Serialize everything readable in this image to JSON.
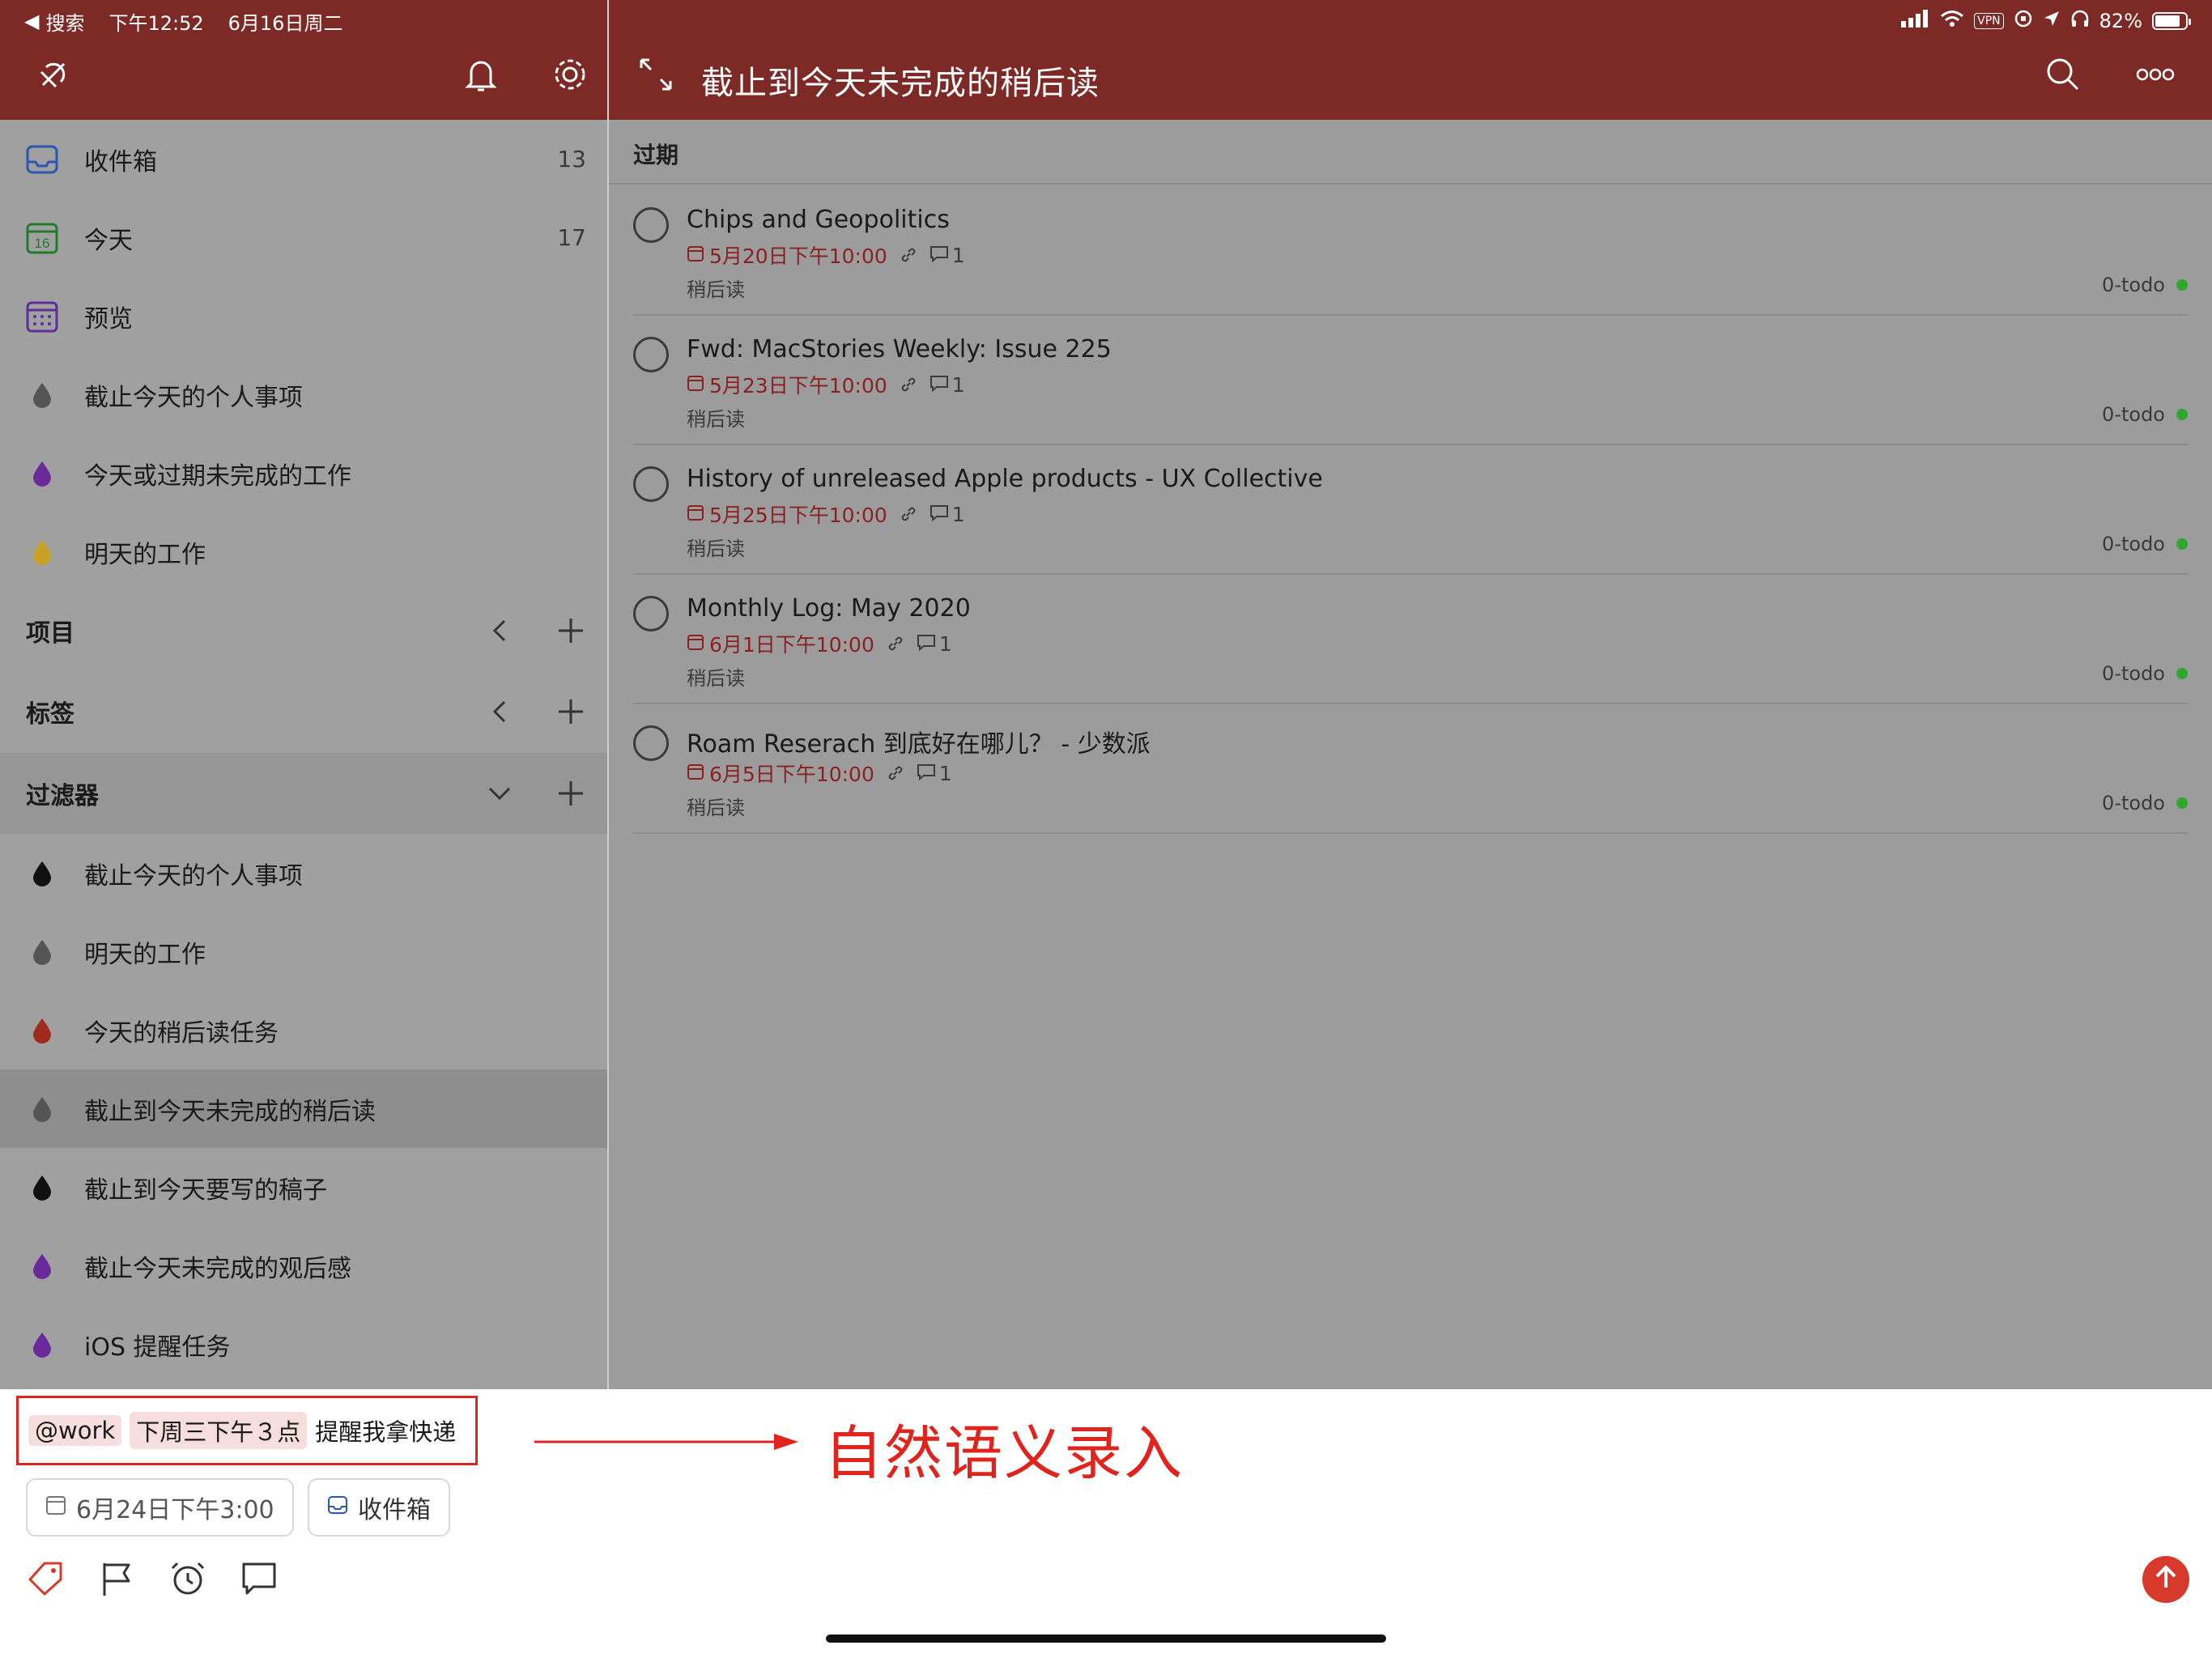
{
  "status_bar": {
    "back_label": "搜索",
    "time": "下午12:52",
    "date": "6月16日周二",
    "vpn": "VPN",
    "battery": "82%"
  },
  "header": {
    "title": "截止到今天未完成的稍后读"
  },
  "sidebar": {
    "top_items": [
      {
        "label": "收件箱",
        "count": "13",
        "icon": "inbox-icon"
      },
      {
        "label": "今天",
        "count": "17",
        "icon": "calendar-today-icon",
        "day": "16"
      },
      {
        "label": "预览",
        "count": "",
        "icon": "calendar-upcoming-icon"
      }
    ],
    "favorites": [
      {
        "label": "截止今天的个人事项",
        "color": "#555555"
      },
      {
        "label": "今天或过期未完成的工作",
        "color": "#6a2a9a"
      },
      {
        "label": "明天的工作",
        "color": "#c8a024"
      }
    ],
    "sections": {
      "projects": "项目",
      "labels": "标签",
      "filters": "过滤器"
    },
    "filters": [
      {
        "label": "截止今天的个人事项",
        "color": "#111111"
      },
      {
        "label": "明天的工作",
        "color": "#555555"
      },
      {
        "label": "今天的稍后读任务",
        "color": "#a02a20"
      },
      {
        "label": "截止到今天未完成的稍后读",
        "color": "#555555"
      },
      {
        "label": "截止到今天要写的稿子",
        "color": "#111111"
      },
      {
        "label": "截止今天未完成的观后感",
        "color": "#6a2a9a"
      },
      {
        "label": "iOS 提醒任务",
        "color": "#6a2a9a"
      }
    ]
  },
  "main": {
    "section_title": "过期",
    "tasks": [
      {
        "title": "Chips and Geopolitics",
        "date": "5月20日下午10:00",
        "comments": "1",
        "project": "稍后读",
        "label": "0-todo"
      },
      {
        "title": "Fwd: MacStories Weekly: Issue 225",
        "date": "5月23日下午10:00",
        "comments": "1",
        "project": "稍后读",
        "label": "0-todo"
      },
      {
        "title": "History of unreleased Apple products - UX Collective",
        "date": "5月25日下午10:00",
        "comments": "1",
        "project": "稍后读",
        "label": "0-todo"
      },
      {
        "title": "Monthly Log: May 2020",
        "date": "6月1日下午10:00",
        "comments": "1",
        "project": "稍后读",
        "label": "0-todo"
      },
      {
        "title": "Roam Reserach 到底好在哪儿？ - 少数派",
        "date": "6月5日下午10:00",
        "comments": "1",
        "project": "稍后读",
        "label": "0-todo"
      }
    ]
  },
  "quick_add": {
    "chip_label": "@work",
    "chip_date": "下周三下午３点",
    "text": "提醒我拿快递",
    "annotation": "自然语义录入",
    "due_date": "6月24日下午3:00",
    "project": "收件箱"
  },
  "colors": {
    "header_bg": "#7d2a26",
    "accent_red": "#d7392c",
    "overdue_red": "#8b2020",
    "label_dot": "#2fa830"
  }
}
